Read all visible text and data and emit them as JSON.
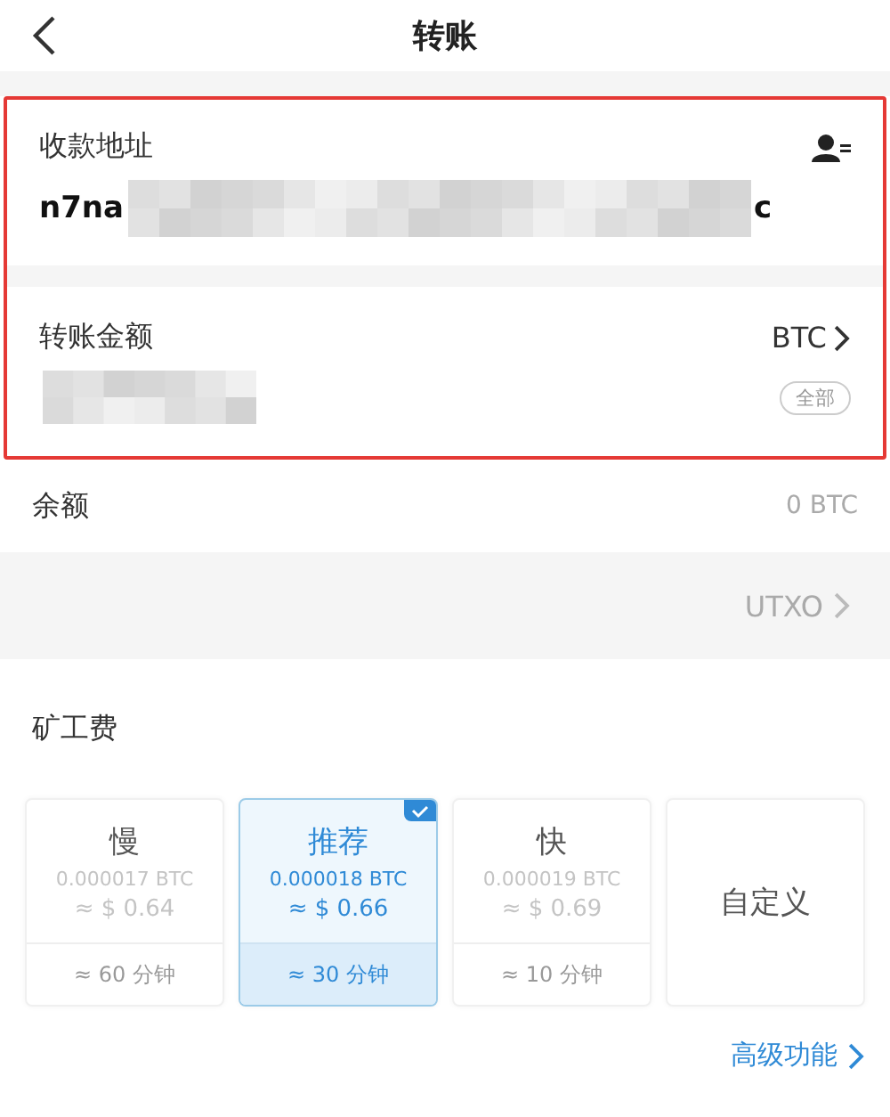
{
  "header": {
    "title": "转账"
  },
  "address": {
    "label": "收款地址",
    "value_start": "n7na",
    "value_end": "c"
  },
  "amount": {
    "label": "转账金额",
    "currency": "BTC",
    "all_button": "全部"
  },
  "balance": {
    "label": "余额",
    "value": "0 BTC"
  },
  "utxo": {
    "label": "UTXO"
  },
  "fee": {
    "title": "矿工费",
    "options": [
      {
        "kind": "preset",
        "name": "慢",
        "btc": "0.000017 BTC",
        "usd": "≈ $ 0.64",
        "time": "≈ 60 分钟",
        "selected": false
      },
      {
        "kind": "preset",
        "name": "推荐",
        "btc": "0.000018 BTC",
        "usd": "≈ $ 0.66",
        "time": "≈ 30 分钟",
        "selected": true
      },
      {
        "kind": "preset",
        "name": "快",
        "btc": "0.000019 BTC",
        "usd": "≈ $ 0.69",
        "time": "≈ 10 分钟",
        "selected": false
      },
      {
        "kind": "custom",
        "name": "自定义",
        "selected": false
      }
    ]
  },
  "advanced": {
    "label": "高级功能"
  }
}
